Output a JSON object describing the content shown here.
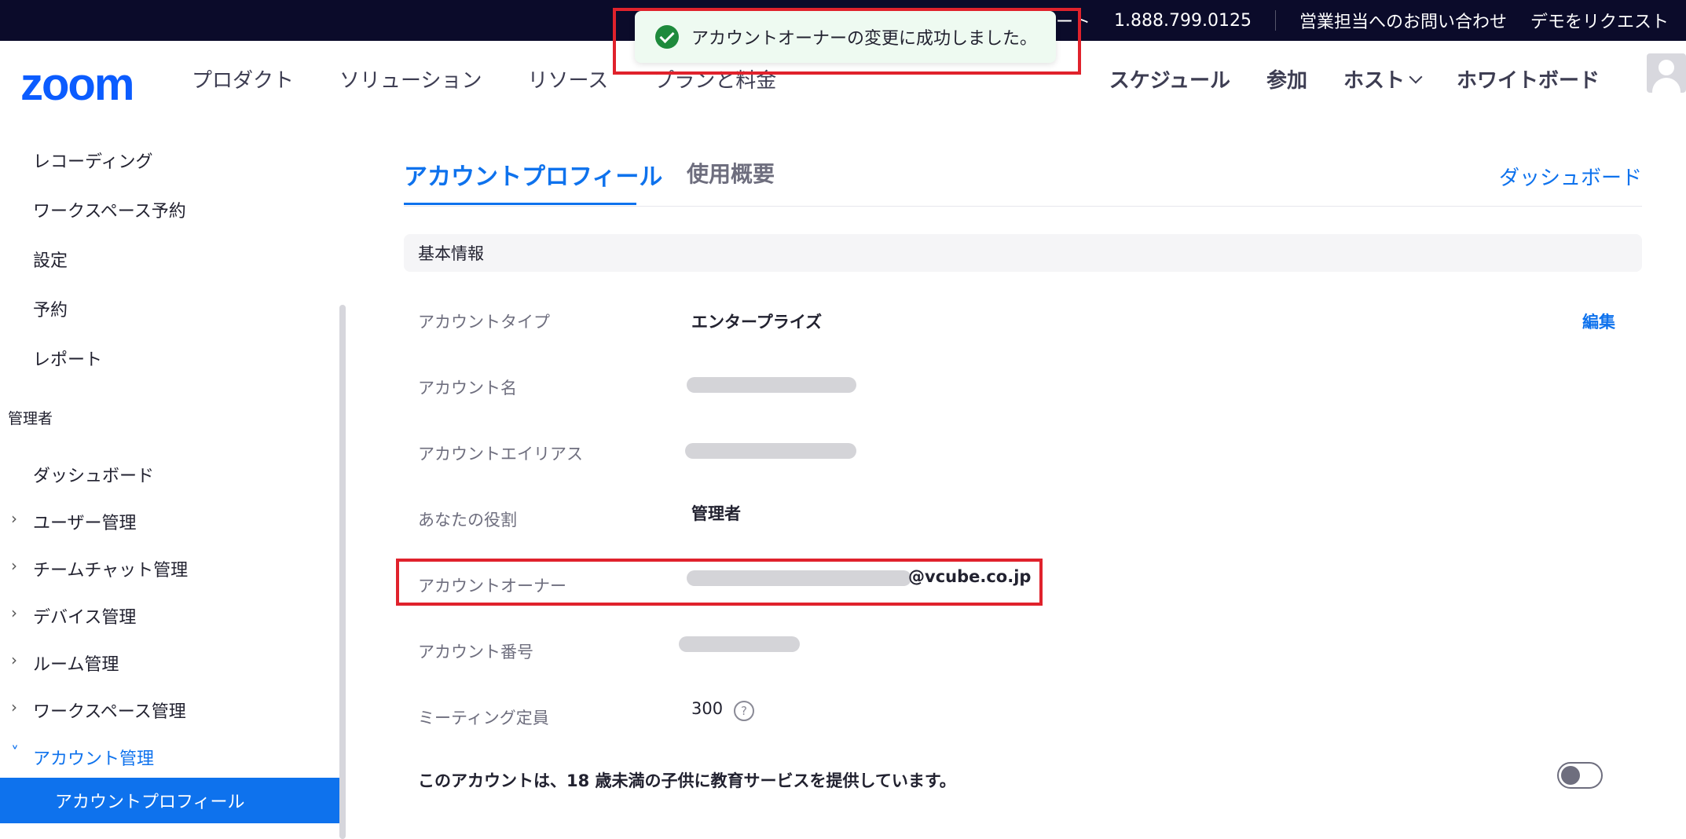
{
  "topbar": {
    "truncated": "...",
    "support": "サポート",
    "phone": "1.888.799.0125",
    "contact_sales": "営業担当へのお問い合わせ",
    "request_demo": "デモをリクエスト"
  },
  "nav": {
    "logo": "zoom",
    "products": "プロダクト",
    "solutions": "ソリューション",
    "resources": "リソース",
    "pricing": "プランと料金",
    "schedule": "スケジュール",
    "join": "参加",
    "host": "ホスト",
    "whiteboard": "ホワイトボード"
  },
  "toast": {
    "message": "アカウントオーナーの変更に成功しました。"
  },
  "sidebar": {
    "recording": "レコーディング",
    "workspace_reservation": "ワークスペース予約",
    "settings": "設定",
    "reservation": "予約",
    "report": "レポート",
    "admin_header": "管理者",
    "dashboard": "ダッシュボード",
    "user_management": "ユーザー管理",
    "team_chat_management": "チームチャット管理",
    "device_management": "デバイス管理",
    "room_management": "ルーム管理",
    "workspace_management": "ワークスペース管理",
    "account_management": "アカウント管理",
    "account_profile": "アカウントプロフィール"
  },
  "tabs": {
    "account_profile": "アカウントプロフィール",
    "usage_overview": "使用概要",
    "dashboard_link": "ダッシュボード"
  },
  "basic_info": {
    "section_title": "基本情報",
    "account_type_label": "アカウントタイプ",
    "account_type_value": "エンタープライズ",
    "edit": "編集",
    "account_name_label": "アカウント名",
    "account_alias_label": "アカウントエイリアス",
    "role_label": "あなたの役割",
    "role_value": "管理者",
    "owner_label": "アカウントオーナー",
    "owner_domain": "@vcube.co.jp",
    "account_number_label": "アカウント番号",
    "meeting_capacity_label": "ミーティング定員",
    "meeting_capacity_value": "300",
    "teen_notice": "このアカウントは、18 歳未満の子供に教育サービスを提供しています。"
  },
  "colors": {
    "accent": "#0e72ed",
    "highlight": "#e0222c",
    "topbar": "#0b0b2a"
  },
  "icons": [
    "check-circle-icon",
    "chevron-down-icon",
    "chevron-right-icon",
    "help-icon",
    "avatar-icon"
  ]
}
